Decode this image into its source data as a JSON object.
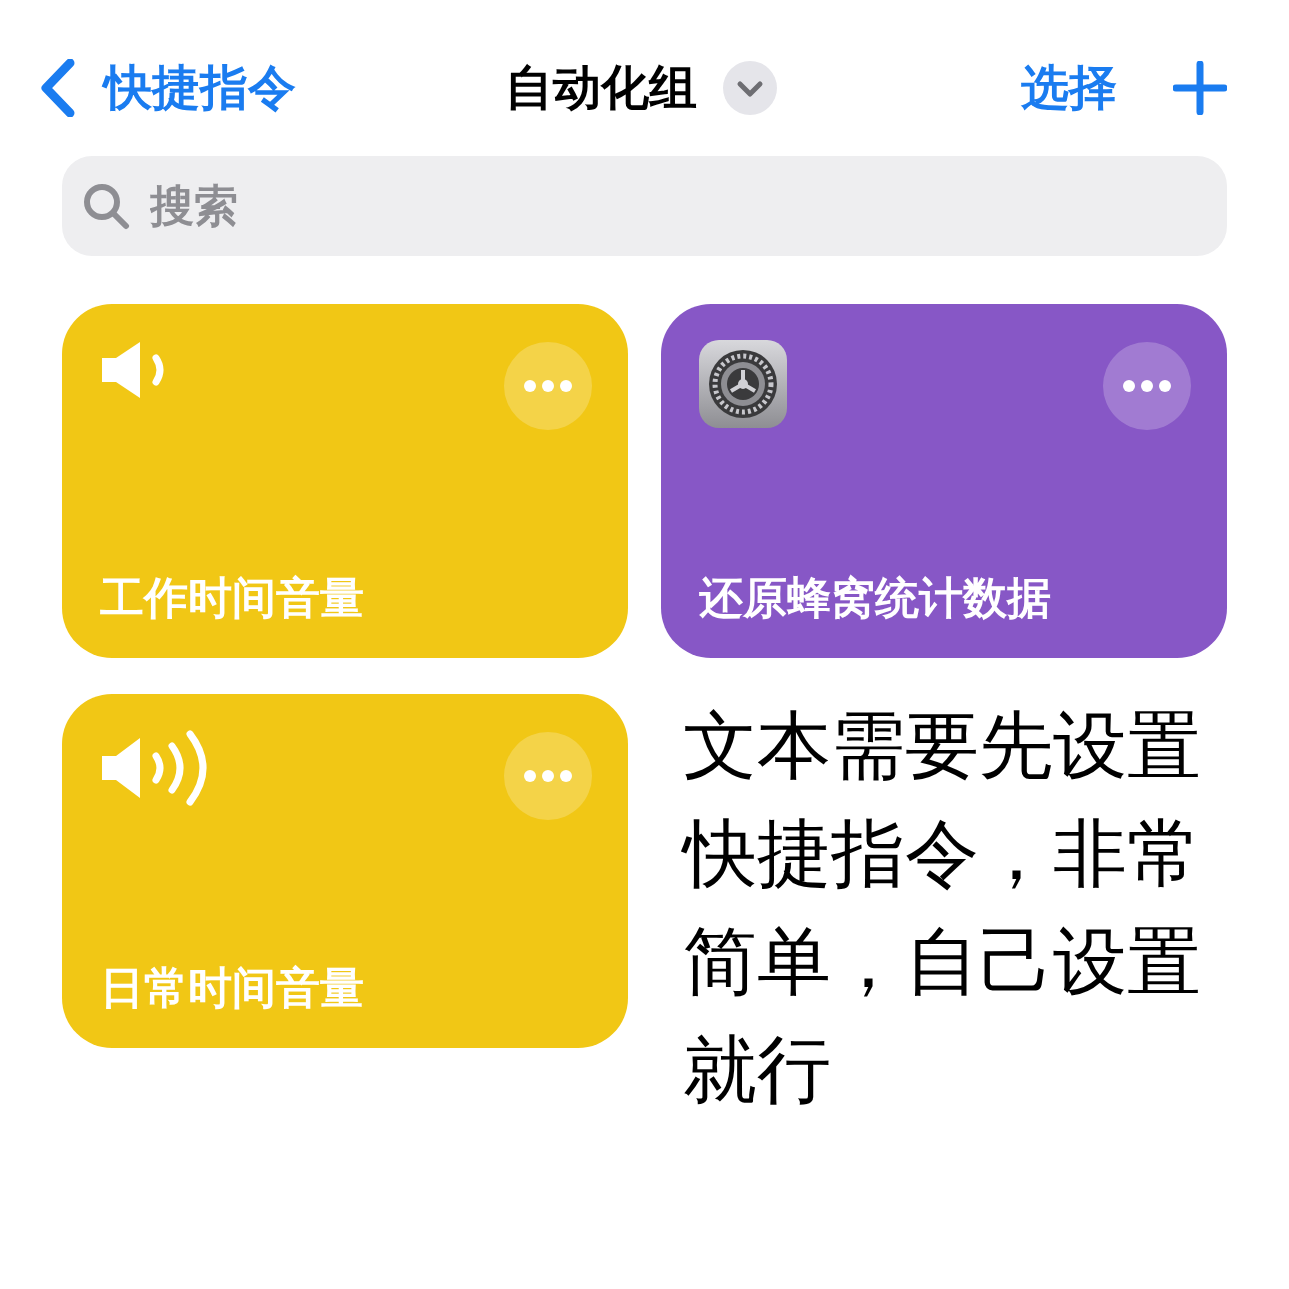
{
  "nav": {
    "back_label": "快捷指令",
    "title": "自动化组",
    "select_label": "选择"
  },
  "search": {
    "placeholder": "搜索"
  },
  "shortcuts": [
    {
      "title": "工作时间音量",
      "kind": "volume-low",
      "color": "#f1c715"
    },
    {
      "title": "还原蜂窝统计数据",
      "kind": "settings",
      "color": "#8757c6"
    },
    {
      "title": "日常时间音量",
      "kind": "volume-high",
      "color": "#f1c715"
    }
  ],
  "note": "文本需要先设置快捷指令，非常简单，自己设置就行"
}
